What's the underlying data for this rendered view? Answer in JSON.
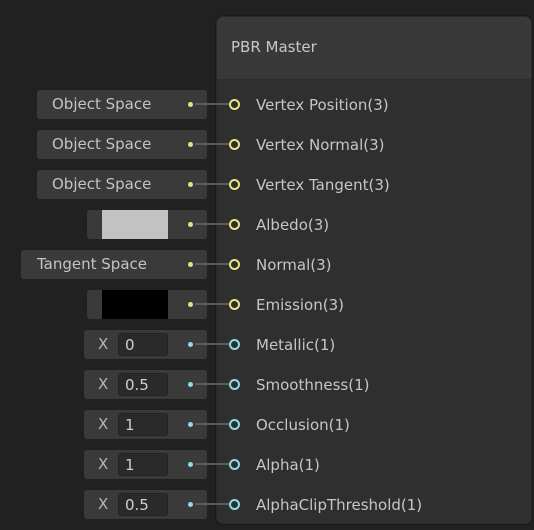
{
  "node": {
    "title": "PBR Master"
  },
  "ports": [
    {
      "label": "Vertex Position(3)",
      "type": "vec3",
      "control": {
        "kind": "space",
        "value": "Object Space"
      }
    },
    {
      "label": "Vertex Normal(3)",
      "type": "vec3",
      "control": {
        "kind": "space",
        "value": "Object Space"
      }
    },
    {
      "label": "Vertex Tangent(3)",
      "type": "vec3",
      "control": {
        "kind": "space",
        "value": "Object Space"
      }
    },
    {
      "label": "Albedo(3)",
      "type": "vec3",
      "control": {
        "kind": "color",
        "value": "#c2c2c2"
      }
    },
    {
      "label": "Normal(3)",
      "type": "vec3",
      "control": {
        "kind": "space",
        "value": "Tangent Space"
      }
    },
    {
      "label": "Emission(3)",
      "type": "vec3",
      "control": {
        "kind": "color",
        "value": "#000000"
      }
    },
    {
      "label": "Metallic(1)",
      "type": "vec1",
      "control": {
        "kind": "float",
        "axis": "X",
        "value": "0"
      }
    },
    {
      "label": "Smoothness(1)",
      "type": "vec1",
      "control": {
        "kind": "float",
        "axis": "X",
        "value": "0.5"
      }
    },
    {
      "label": "Occlusion(1)",
      "type": "vec1",
      "control": {
        "kind": "float",
        "axis": "X",
        "value": "1"
      }
    },
    {
      "label": "Alpha(1)",
      "type": "vec1",
      "control": {
        "kind": "float",
        "axis": "X",
        "value": "1"
      }
    },
    {
      "label": "AlphaClipThreshold(1)",
      "type": "vec1",
      "control": {
        "kind": "float",
        "axis": "X",
        "value": "0.5"
      }
    }
  ],
  "colors": {
    "vec3_port": "#e6e486",
    "vec1_port": "#8fdcea",
    "node_bg": "#2f2f2f",
    "canvas_bg": "#212121"
  }
}
